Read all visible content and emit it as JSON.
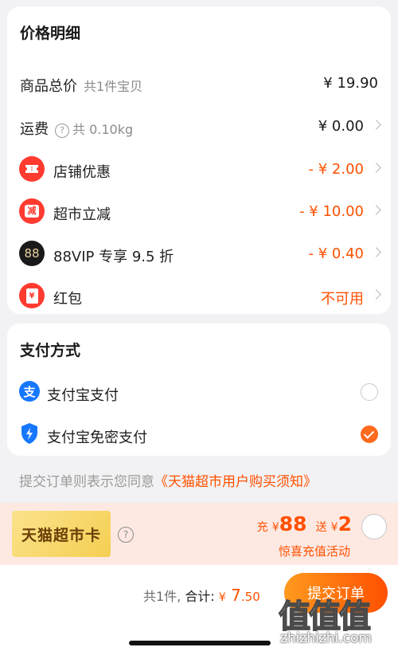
{
  "price_details": {
    "title": "价格明细",
    "rows": [
      {
        "label": "商品总价",
        "sub": "共1件宝贝",
        "value": "¥ 19.90"
      },
      {
        "label": "运费",
        "sub": "共 0.10kg",
        "value": "¥ 0.00"
      },
      {
        "label": "店铺优惠",
        "value": "- ¥ 2.00",
        "icon": "shop-coupon-icon"
      },
      {
        "label": "超市立减",
        "value": "- ¥ 10.00",
        "icon": "supermarket-discount-icon",
        "icon_text": "减"
      },
      {
        "label": "88VIP 专享 9.5 折",
        "value": "- ¥ 0.40",
        "icon": "88vip-icon",
        "icon_text": "88"
      },
      {
        "label": "红包",
        "value": "不可用",
        "icon": "red-packet-icon",
        "icon_text": "¥"
      }
    ]
  },
  "payment": {
    "title": "支付方式",
    "options": [
      {
        "label": "支付宝支付",
        "icon": "alipay-icon",
        "icon_text": "支",
        "selected": false
      },
      {
        "label": "支付宝免密支付",
        "icon": "alipay-shield-icon",
        "selected": true
      }
    ]
  },
  "agreement": {
    "prefix": "提交订单则表示您同意",
    "link": "《天猫超市用户购买须知》"
  },
  "promo": {
    "card_label": "天猫超市卡",
    "help_glyph": "?",
    "charge_prefix": "充",
    "currency": "¥",
    "charge_amount": "88",
    "gift_prefix": "送",
    "gift_amount": "2",
    "sub_text": "惊喜充值活动"
  },
  "footer": {
    "count_text": "共1件,",
    "total_label": "合计:",
    "currency": "¥",
    "total_int": " 7",
    ".total_dec": "",
    "total_dec": ".50",
    "submit_label": "提交订单"
  },
  "watermark": {
    "logo_text": "值值值",
    "site": "zhizhizhi.com"
  },
  "colors": {
    "accent": "#ff5000",
    "page_bg": "#f2f2f4"
  }
}
